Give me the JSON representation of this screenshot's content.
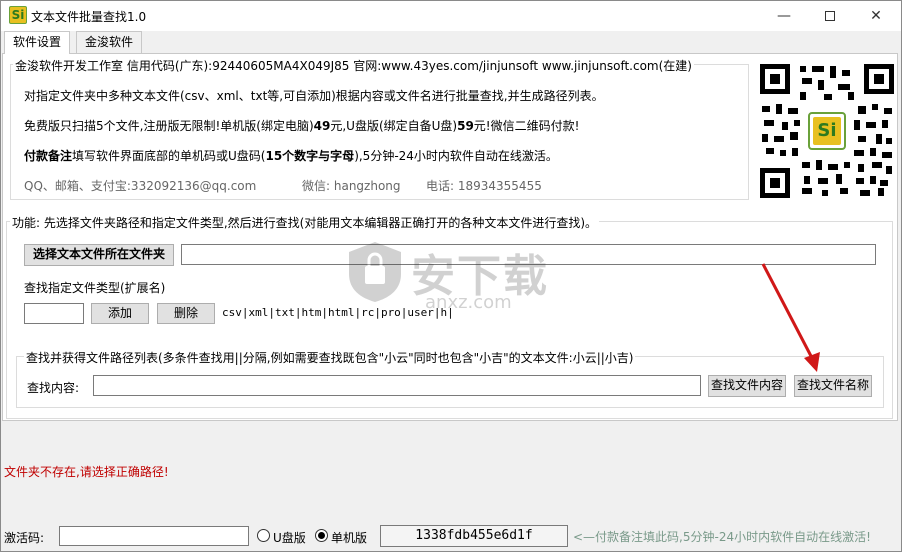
{
  "window": {
    "title": "文本文件批量查找1.0",
    "icon_letter": "Si",
    "minimize_glyph": "—",
    "close_glyph": "✕"
  },
  "tabs": [
    {
      "label": "软件设置",
      "active": true
    },
    {
      "label": "金浚软件",
      "active": false
    }
  ],
  "info": {
    "legend": "金浚软件开发工作室 信用代码(广东):92440605MA4X049J85 官网:www.43yes.com/jinjunsoft  www.jinjunsoft.com(在建)",
    "line1": "对指定文件夹中多种文本文件(csv、xml、txt等,可自添加)根据内容或文件名进行批量查找,并生成路径列表。",
    "line2_prefix": "免费版只扫描5个文件,注册版无限制!单机版(绑定电脑)",
    "line2_price1": "49",
    "line2_mid": "元,U盘版(绑定自备U盘)",
    "line2_price2": "59",
    "line2_suffix": "元!微信二维码付款!",
    "line3_bold": "付款备注",
    "line3_mid": "填写软件界面底部的单机码或U盘码(",
    "line3_bold2": "15个数字与字母",
    "line3_suffix": "),5分钟-24小时内软件自动在线激活。",
    "contact_qq": "QQ、邮箱、支付宝:332092136@qq.com",
    "contact_wechat": "微信: hangzhong",
    "contact_phone": "电话: 18934355455"
  },
  "function_group": {
    "legend": "功能: 先选择文件夹路径和指定文件类型,然后进行查找(对能用文本编辑器正确打开的各种文本文件进行查找)。",
    "select_folder_button": "选择文本文件所在文件夹",
    "folder_path_value": "",
    "file_type_label": "查找指定文件类型(扩展名)",
    "file_type_input_value": "",
    "add_button": "添加",
    "delete_button": "删除",
    "file_types": "csv|xml|txt|htm|html|rc|pro|user|h|"
  },
  "search_group": {
    "legend": "查找并获得文件路径列表(多条件查找用||分隔,例如需要查找既包含\"小云\"同时也包含\"小吉\"的文本文件:小云||小吉)",
    "content_label": "查找内容:",
    "content_value": "",
    "search_content_button": "查找文件内容",
    "search_name_button": "查找文件名称"
  },
  "status": {
    "message": "文件夹不存在,请选择正确路径!"
  },
  "bottom": {
    "activation_label": "激活码:",
    "activation_value": "",
    "usb_label": "U盘版",
    "usb_checked": false,
    "standalone_label": "单机版",
    "standalone_checked": true,
    "machine_code": "1338fdb455e6d1f",
    "hint": "<—付款备注填此码,5分钟-24小时内软件自动在线激活!"
  },
  "watermark": {
    "text_cn": "安下载",
    "text_en": "anxz.com"
  },
  "colors": {
    "status_error": "#c00000",
    "arrow": "#d01818",
    "hint": "#7a9a8a",
    "icon_bg": "#e8c020",
    "icon_fg": "#2d7a1f"
  }
}
